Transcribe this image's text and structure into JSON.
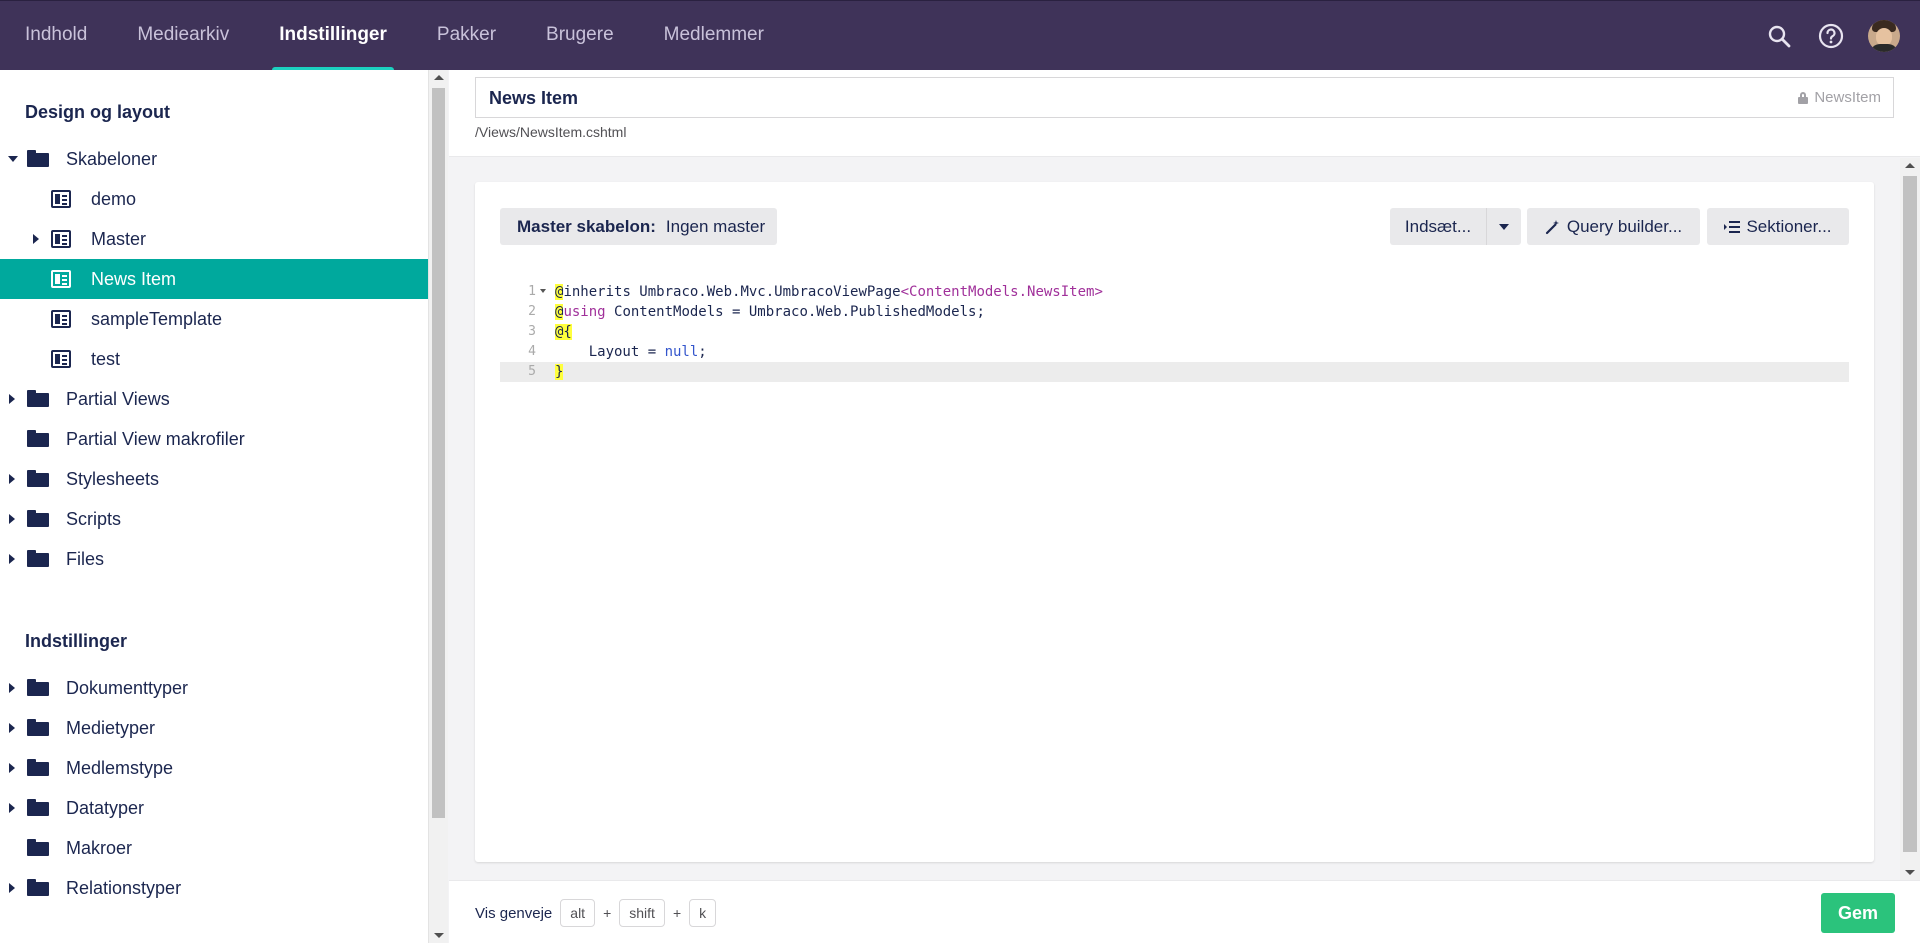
{
  "nav": {
    "items": [
      {
        "label": "Indhold"
      },
      {
        "label": "Mediearkiv"
      },
      {
        "label": "Indstillinger",
        "active": true
      },
      {
        "label": "Pakker"
      },
      {
        "label": "Brugere"
      },
      {
        "label": "Medlemmer"
      }
    ],
    "icons": [
      "search-icon",
      "help-icon",
      "avatar"
    ]
  },
  "sidebar": {
    "section1_title": "Design og layout",
    "section2_title": "Indstillinger",
    "tree": [
      {
        "label": "Skabeloner",
        "icon": "folder-icon",
        "expanded": true
      },
      {
        "label": "demo",
        "icon": "template-icon"
      },
      {
        "label": "Master",
        "icon": "template-icon",
        "has_children": true
      },
      {
        "label": "News Item",
        "icon": "template-icon",
        "selected": true
      },
      {
        "label": "sampleTemplate",
        "icon": "template-icon"
      },
      {
        "label": "test",
        "icon": "template-icon"
      },
      {
        "label": "Partial Views",
        "icon": "folder-icon",
        "has_children": true
      },
      {
        "label": "Partial View makrofiler",
        "icon": "folder-icon"
      },
      {
        "label": "Stylesheets",
        "icon": "folder-icon",
        "has_children": true
      },
      {
        "label": "Scripts",
        "icon": "folder-icon",
        "has_children": true
      },
      {
        "label": "Files",
        "icon": "folder-icon",
        "has_children": true
      }
    ],
    "tree2": [
      {
        "label": "Dokumenttyper",
        "icon": "folder-icon",
        "has_children": true
      },
      {
        "label": "Medietyper",
        "icon": "folder-icon",
        "has_children": true
      },
      {
        "label": "Medlemstype",
        "icon": "folder-icon",
        "has_children": true
      },
      {
        "label": "Datatyper",
        "icon": "folder-icon",
        "has_children": true
      },
      {
        "label": "Makroer",
        "icon": "folder-icon"
      },
      {
        "label": "Relationstyper",
        "icon": "folder-icon",
        "has_children": true
      }
    ]
  },
  "header": {
    "name_value": "News Item",
    "alias": "NewsItem",
    "path": "/Views/NewsItem.cshtml"
  },
  "toolbar": {
    "master_label": "Master skabelon:",
    "master_value": "Ingen master",
    "insert_label": "Indsæt...",
    "query_label": "Query builder...",
    "sections_label": "Sektioner..."
  },
  "code": {
    "lines": [
      {
        "n": "1",
        "text": "@inherits Umbraco.Web.Mvc.UmbracoViewPage<ContentModels.NewsItem>"
      },
      {
        "n": "2",
        "text": "@using ContentModels = Umbraco.Web.PublishedModels;"
      },
      {
        "n": "3",
        "text": "@{"
      },
      {
        "n": "4",
        "text": "    Layout = null;"
      },
      {
        "n": "5",
        "text": "}"
      }
    ]
  },
  "footer": {
    "shortcut_label": "Vis genveje",
    "keys": [
      "alt",
      "shift",
      "k"
    ],
    "plus": "+",
    "save_label": "Gem"
  },
  "colors": {
    "topbar": "#3f3359",
    "accent": "#1cd1c0",
    "selected": "#00a99d",
    "save": "#2bc37c"
  }
}
